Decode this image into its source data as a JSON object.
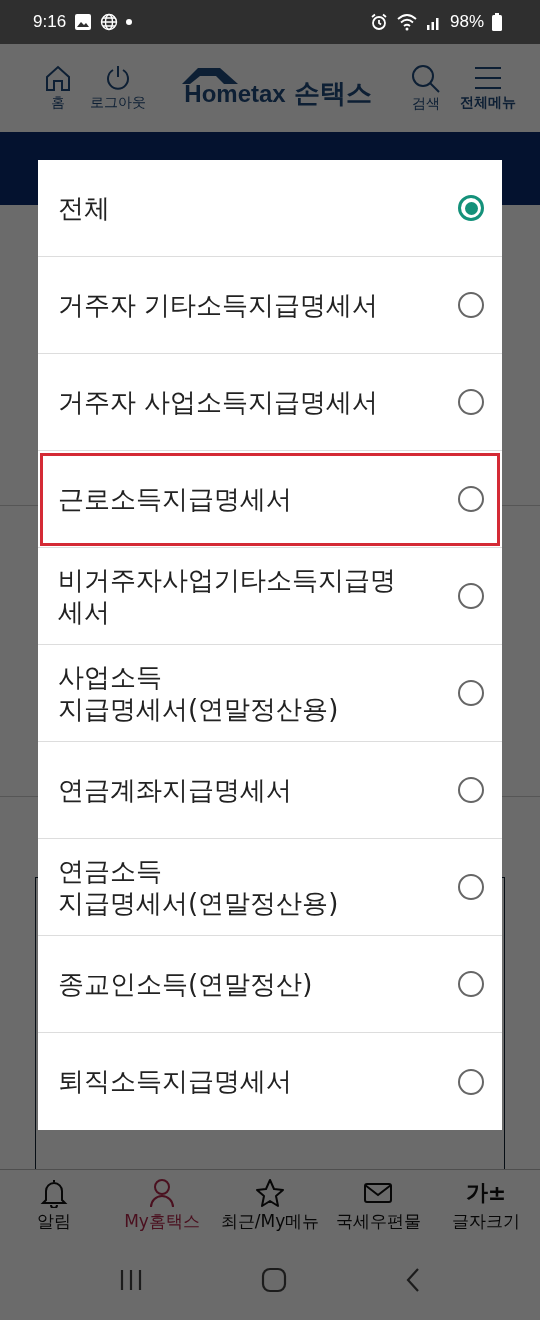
{
  "status_bar": {
    "time": "9:16",
    "battery": "98%"
  },
  "header": {
    "home_label": "홈",
    "logout_label": "로그아웃",
    "logo_latin": "Hometax",
    "logo_korean": "손택스",
    "search_label": "검색",
    "menu_label": "전체메뉴"
  },
  "dialog": {
    "options": [
      {
        "label": "전체",
        "selected": true,
        "highlighted": false
      },
      {
        "label": "거주자 기타소득지급명세서",
        "selected": false,
        "highlighted": false
      },
      {
        "label": "거주자 사업소득지급명세서",
        "selected": false,
        "highlighted": false
      },
      {
        "label": "근로소득지급명세서",
        "selected": false,
        "highlighted": true
      },
      {
        "label": "비거주자사업기타소득지급명세서",
        "selected": false,
        "highlighted": false
      },
      {
        "label": "사업소득\n지급명세서(연말정산용)",
        "selected": false,
        "highlighted": false
      },
      {
        "label": "연금계좌지급명세서",
        "selected": false,
        "highlighted": false
      },
      {
        "label": "연금소득\n지급명세서(연말정산용)",
        "selected": false,
        "highlighted": false
      },
      {
        "label": "종교인소득(연말정산)",
        "selected": false,
        "highlighted": false
      },
      {
        "label": "퇴직소득지급명세서",
        "selected": false,
        "highlighted": false
      }
    ]
  },
  "bottom_nav": [
    {
      "kind": "bell",
      "label": "알림",
      "selected": false
    },
    {
      "kind": "person",
      "label": "My홈택스",
      "selected": true
    },
    {
      "kind": "star",
      "label": "최근/My메뉴",
      "selected": false
    },
    {
      "kind": "envelope",
      "label": "국세우편물",
      "selected": false
    },
    {
      "kind": "glyph",
      "glyph": "가±",
      "label": "글자크기",
      "selected": false
    }
  ]
}
